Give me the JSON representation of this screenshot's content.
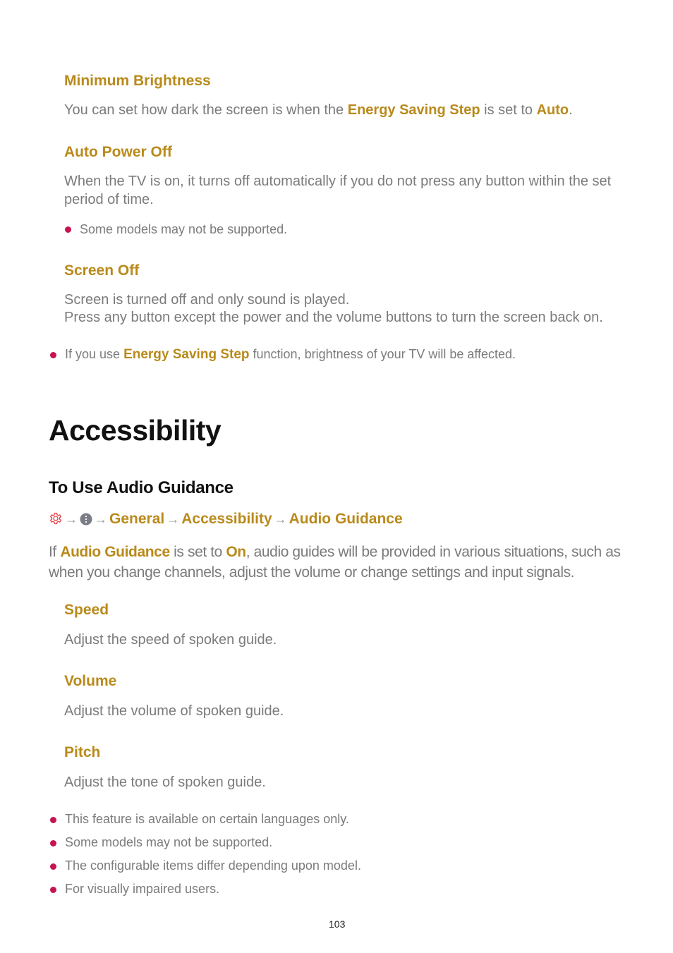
{
  "sections": {
    "minimum_brightness": {
      "title": "Minimum Brightness",
      "text_1": "You can set how dark the screen is when the ",
      "hl_1": "Energy Saving Step",
      "text_2": " is set to ",
      "hl_2": "Auto",
      "text_3": "."
    },
    "auto_power_off": {
      "title": "Auto Power Off",
      "text": "When the TV is on, it turns off automatically if you do not press any button within the set period of time.",
      "note": "Some models may not be supported."
    },
    "screen_off": {
      "title": "Screen Off",
      "line_1": "Screen is turned off and only sound is played.",
      "line_2": "Press any button except the power and the volume buttons to turn the screen back on."
    },
    "energy_note": {
      "text_1": "If you use ",
      "hl": "Energy Saving Step",
      "text_2": " function, brightness of your TV will be affected."
    }
  },
  "accessibility": {
    "title": "Accessibility",
    "subtitle": "To Use Audio Guidance",
    "breadcrumb": {
      "icons": [
        "settings-gear-icon",
        "more-options-icon"
      ],
      "arrow": "→",
      "items": [
        "General",
        "Accessibility",
        "Audio Guidance"
      ]
    },
    "intro": {
      "text_1": "If ",
      "hl_1": "Audio Guidance",
      "text_2": " is set to ",
      "hl_2": "On",
      "text_3": ", audio guides will be provided in various situations, such as when you change channels, adjust the volume or change settings and input signals."
    },
    "options": [
      {
        "title": "Speed",
        "text": "Adjust the speed of spoken guide."
      },
      {
        "title": "Volume",
        "text": "Adjust the volume of spoken guide."
      },
      {
        "title": "Pitch",
        "text": "Adjust the tone of spoken guide."
      }
    ],
    "notes": [
      "This feature is available on certain languages only.",
      "Some models may not be supported.",
      "The configurable items differ depending upon model.",
      "For visually impaired users."
    ]
  },
  "colors": {
    "accent": "#b98a1b",
    "bullet": "#c8134f",
    "body_text": "#7b7b7b",
    "heading": "#111111",
    "gear_icon": "#e0424a"
  },
  "page_number": "103"
}
